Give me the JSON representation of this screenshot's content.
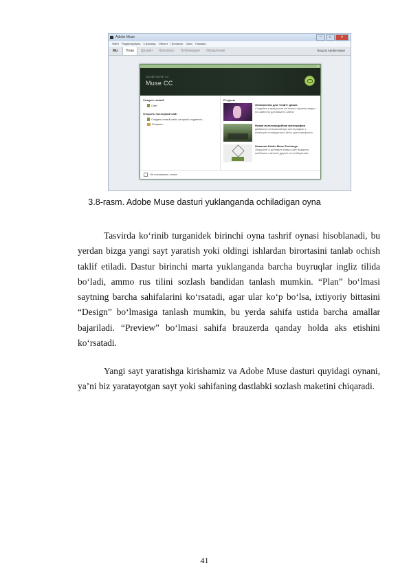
{
  "figure": {
    "window_title": "Adobe Muse",
    "window_buttons": [
      "–",
      "□",
      "✕"
    ],
    "menu": [
      "Файл",
      "Редактировать",
      "Страница",
      "Объект",
      "Просмотр",
      "Окно",
      "Справка"
    ],
    "logo": "Mu",
    "tabs": [
      "План",
      "Дизайн",
      "Просмотр",
      "Публикация",
      "Управление"
    ],
    "active_tab_index": 0,
    "login": "Вход в Adobe Muse",
    "dialog": {
      "banner_subtitle": "ADOBE MUSE CC",
      "product": "Muse CC",
      "left_heading": "Создать новый",
      "left_items": [
        "Сайт"
      ],
      "recent_heading": "Открыть последний сайт",
      "recent_items": [
        "Создать новый сайт, который создается...",
        "Открыть..."
      ],
      "right_heading": "Ресурсы",
      "resources": [
        {
          "title": "Обновления для «Сайт» двоих",
          "desc": "Создайте и выпустите на новых страниц видео по шаблону для вашего сайта."
        },
        {
          "title": "Новая мультимедийная фотография",
          "desc": "Добавьте интерактивную фотографию с помощью стандартного фото для портфолио."
        },
        {
          "title": "Новинки Adobe Muse Exchange",
          "desc": "Загрузите и добавьте в ваш сайт виджеты, шаблоны и многое другое из сообщества."
        }
      ],
      "footer_checkbox": "Не показывать снова"
    }
  },
  "caption": "3.8-rasm. Adobe Muse dasturi yuklanganda ochiladigan oyna",
  "paragraphs": [
    "Tasvirda ko‘rinib turganidek birinchi oyna tashrif oynasi hisoblanadi, bu yerdan bizga yangi sayt yaratish yoki oldingi ishlardan birortasini tanlab ochish taklif etiladi. Dastur birinchi marta yuklanganda barcha buyruqlar ingliz tilida bo‘ladi, ammo rus tilini sozlash bandidan tanlash mumkin. “Plan” bo‘lmasi saytning barcha sahifalarini ko‘rsatadi, agar ular ko‘p bo‘lsa, ixtiyoriy bittasini “Design” bo‘lmasiga tanlash mumkin, bu yerda sahifa ustida barcha amallar bajariladi. “Preview” bo‘lmasi sahifa brauzerda qanday holda aks etishini ko‘rsatadi.",
    "Yangi sayt yaratishga kirishamiz va Adobe Muse dasturi quyidagi oynani, ya’ni biz yaratayotgan sayt yoki sahifaning dastlabki sozlash maketini chiqaradi."
  ],
  "page_number": "41"
}
